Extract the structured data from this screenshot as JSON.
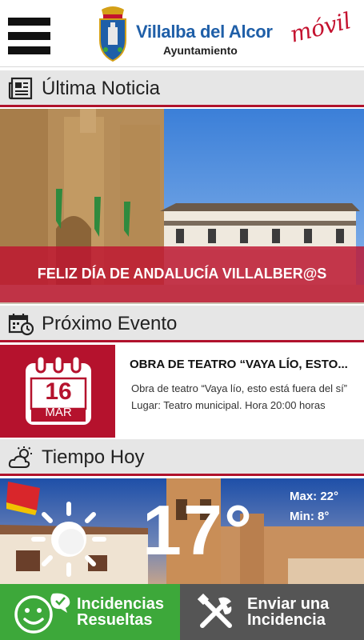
{
  "header": {
    "brand_title": "Villalba del Alcor",
    "brand_subtitle": "Ayuntamiento",
    "brand_tag": "móvil",
    "menu_icon": "hamburger-icon",
    "logo_icon": "coat-of-arms-icon"
  },
  "sections": {
    "news": {
      "title": "Última Noticia",
      "icon": "newspaper-icon"
    },
    "event": {
      "title": "Próximo Evento",
      "icon": "calendar-clock-icon"
    },
    "weather": {
      "title": "Tiempo Hoy",
      "icon": "partly-cloudy-icon"
    }
  },
  "news": {
    "headline": "FELIZ DÍA DE ANDALUCÍA VILLALBER@S"
  },
  "event": {
    "day": "16",
    "month": "MAR",
    "title": "OBRA DE TEATRO “VAYA LÍO, ESTO...",
    "description": "Obra de teatro “Vaya lío, esto está fuera del sí”   Lugar: Teatro municipal.  Hora 20:00 horas"
  },
  "weather": {
    "temperature": "17°",
    "max": "Max: 22°",
    "min": "Min: 8°",
    "icon": "sun-icon"
  },
  "buttons": {
    "left_line1": "Incidencias",
    "left_line2": "Resueltas",
    "right_line1": "Enviar una",
    "right_line2": "Incidencia"
  },
  "colors": {
    "accent_red": "#b5122d",
    "brand_blue": "#1f5fa8",
    "green": "#3da83a",
    "dark_gray": "#555555"
  }
}
